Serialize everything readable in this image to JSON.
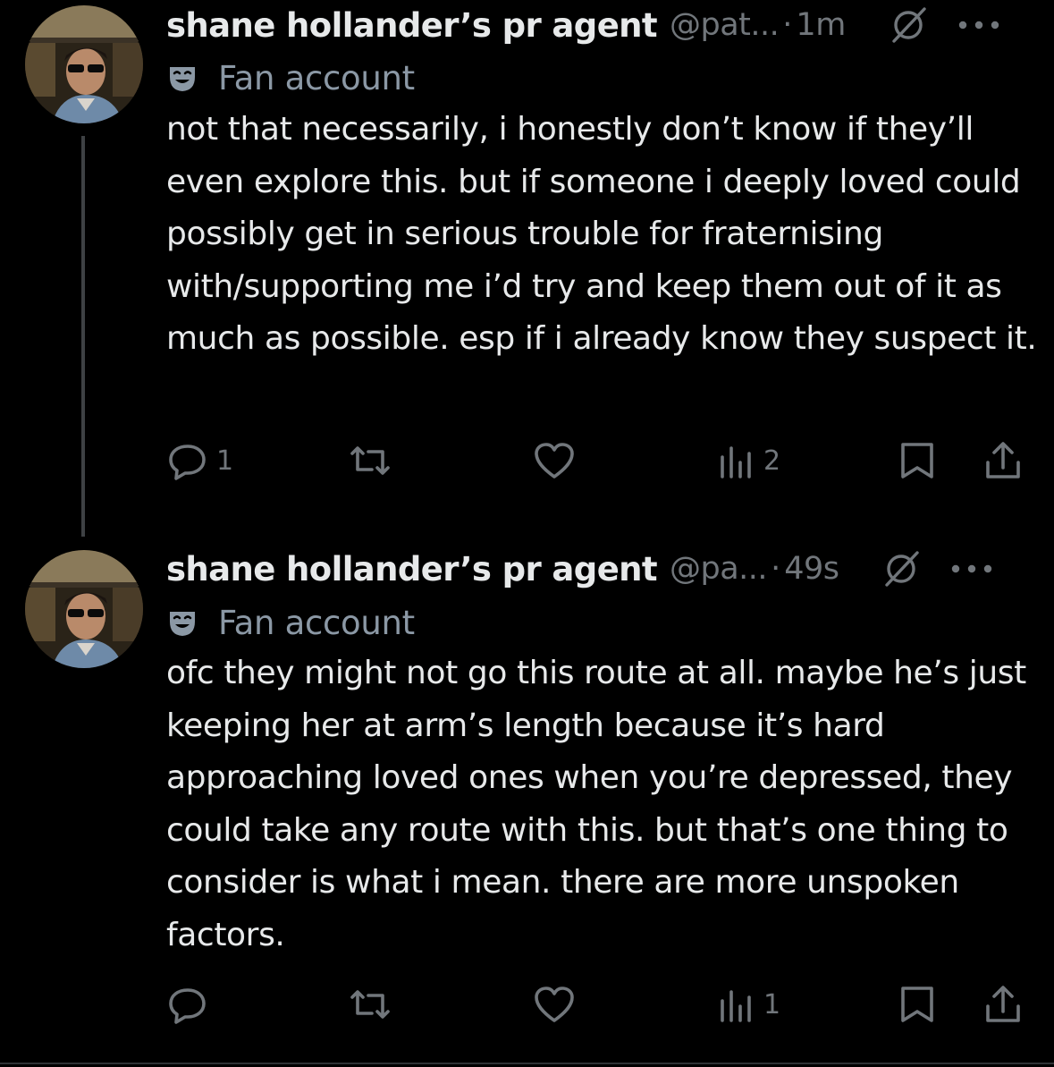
{
  "tweets": [
    {
      "display_name": "shane hollander’s pr agent",
      "handle": "@pat...",
      "separator": "·",
      "time": "1m",
      "label": "Fan account",
      "text": "not that necessarily, i honestly don’t know if they’ll even explore this. but if someone i deeply loved could possibly get in serious trouble for fraternising with/supporting me i’d try and keep them out of it as much as possible. esp if i already know they suspect it.",
      "replies": "1",
      "reposts": "",
      "likes": "",
      "views": "2"
    },
    {
      "display_name": "shane hollander’s pr agent",
      "handle": "@pa...",
      "separator": "·",
      "time": "49s",
      "label": "Fan account",
      "text": "ofc they might not go this route at all. maybe he’s just keeping her at arm’s length because it’s hard approaching loved ones when you’re depressed, they could take any route with this. but that’s one thing to consider is what i mean. there are more unspoken factors.",
      "replies": "",
      "reposts": "",
      "likes": "",
      "views": "1"
    }
  ],
  "icons": {
    "grok": "grok-icon",
    "more": "more-options-icon",
    "label": "theater-mask-icon",
    "reply": "reply-icon",
    "repost": "repost-icon",
    "like": "heart-icon",
    "views": "views-chart-icon",
    "bookmark": "bookmark-icon",
    "share": "share-icon"
  },
  "colors": {
    "background": "#000000",
    "text": "#e7e9ea",
    "secondary": "#71767b",
    "label": "#8b98a5",
    "thread_line": "#3e4144"
  }
}
